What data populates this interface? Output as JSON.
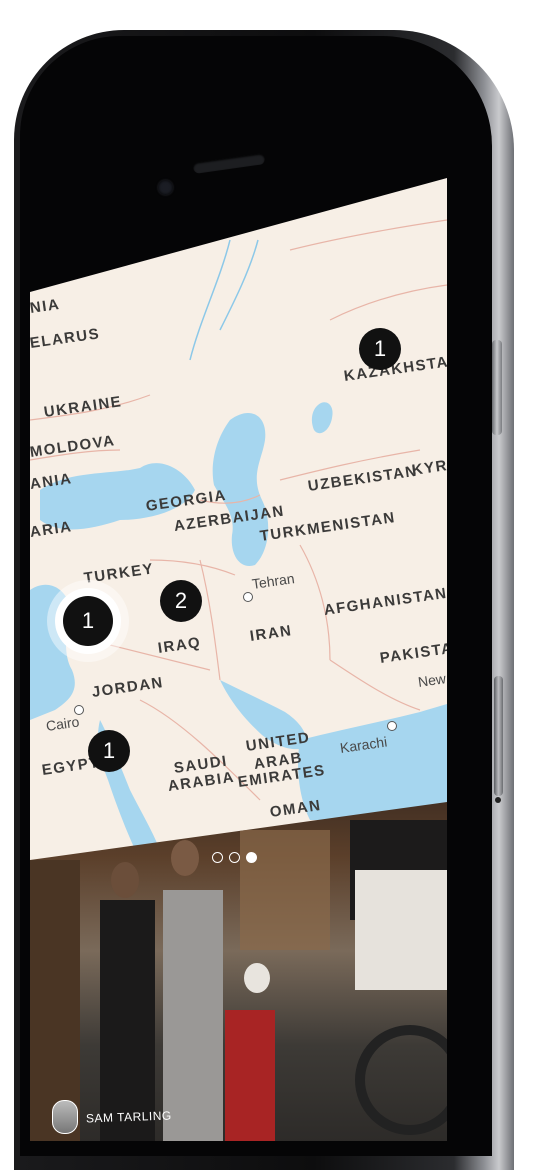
{
  "map": {
    "countries": [
      "NIA",
      "ELARUS",
      "UKRAINE",
      "MOLDOVA",
      "ANIA",
      "ARIA",
      "GEORGIA",
      "AZERBAIJAN",
      "TURKEY",
      "IRAQ",
      "IRAN",
      "JORDAN",
      "EGYPT",
      "SAUDI",
      "ARABIA",
      "UNITED",
      "ARAB",
      "EMIRATES",
      "OMAN",
      "UZBEKISTAN",
      "KYRG",
      "TURKMENISTAN",
      "AFGHANISTAN",
      "PAKISTA",
      "KAZAKHSTAN"
    ],
    "cities": [
      "Cairo",
      "Tehran",
      "Karachi",
      "New"
    ]
  },
  "pins": [
    {
      "count": "1",
      "place": "Kazakhstan"
    },
    {
      "count": "1",
      "place": "Turkey",
      "selected": true
    },
    {
      "count": "2",
      "place": "Iraq"
    },
    {
      "count": "1",
      "place": "Egypt"
    }
  ],
  "photo": {
    "pager_total": 3,
    "pager_active": 3,
    "credit": "SAM TARLING"
  }
}
